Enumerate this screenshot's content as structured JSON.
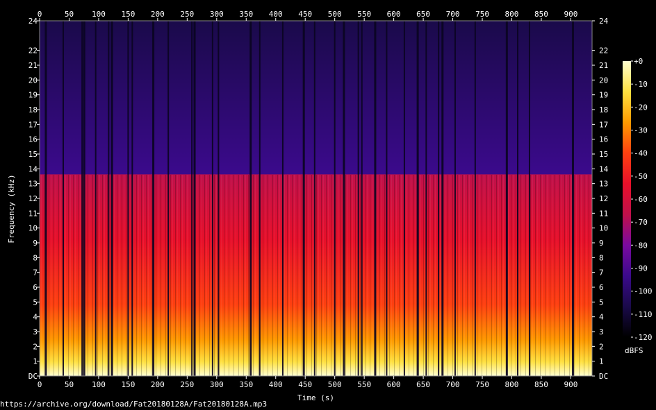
{
  "source_url": "https://archive.org/download/Fat20180128A/Fat20180128A.mp3",
  "chart_data": {
    "type": "heatmap",
    "subtype": "spectrogram",
    "xlabel": "Time (s)",
    "ylabel": "Frequency (kHz)",
    "xlim": [
      0,
      936
    ],
    "ylim": [
      0,
      24
    ],
    "x_ticks": [
      "0",
      "50",
      "100",
      "150",
      "200",
      "250",
      "300",
      "350",
      "400",
      "450",
      "500",
      "550",
      "600",
      "650",
      "700",
      "750",
      "800",
      "850",
      "900"
    ],
    "y_ticks": [
      "DC",
      "1",
      "2",
      "3",
      "4",
      "5",
      "6",
      "7",
      "8",
      "9",
      "10",
      "11",
      "12",
      "13",
      "14",
      "15",
      "16",
      "17",
      "18",
      "19",
      "20",
      "21",
      "22",
      "24"
    ],
    "y_tick_values": [
      0,
      1,
      2,
      3,
      4,
      5,
      6,
      7,
      8,
      9,
      10,
      11,
      12,
      13,
      14,
      15,
      16,
      17,
      18,
      19,
      20,
      21,
      22,
      24
    ],
    "lowpass_cutoff_khz": 13.6,
    "silence_gaps_s": [
      10,
      40,
      72,
      75,
      95,
      117,
      122,
      150,
      157,
      192,
      218,
      258,
      262,
      293,
      303,
      357,
      373,
      412,
      447,
      466,
      500,
      515,
      540,
      546,
      568,
      588,
      618,
      640,
      655,
      676,
      682,
      704,
      738,
      791,
      810,
      830,
      903
    ],
    "colorbar": {
      "unit": "dBFS",
      "range": [
        -120,
        0
      ],
      "ticks": [
        "+0",
        "-10",
        "-20",
        "-30",
        "-40",
        "-50",
        "-60",
        "-70",
        "-80",
        "-90",
        "-100",
        "-110",
        "-120"
      ],
      "tick_values": [
        0,
        -10,
        -20,
        -30,
        -40,
        -50,
        -60,
        -70,
        -80,
        -90,
        -100,
        -110,
        -120
      ]
    },
    "grid": false,
    "colormap": [
      "#000000",
      "#1a0a4a",
      "#3b0a8c",
      "#7a0aa0",
      "#c0104a",
      "#e8102a",
      "#ff4010",
      "#ff9a00",
      "#ffe040",
      "#ffffd0"
    ]
  }
}
